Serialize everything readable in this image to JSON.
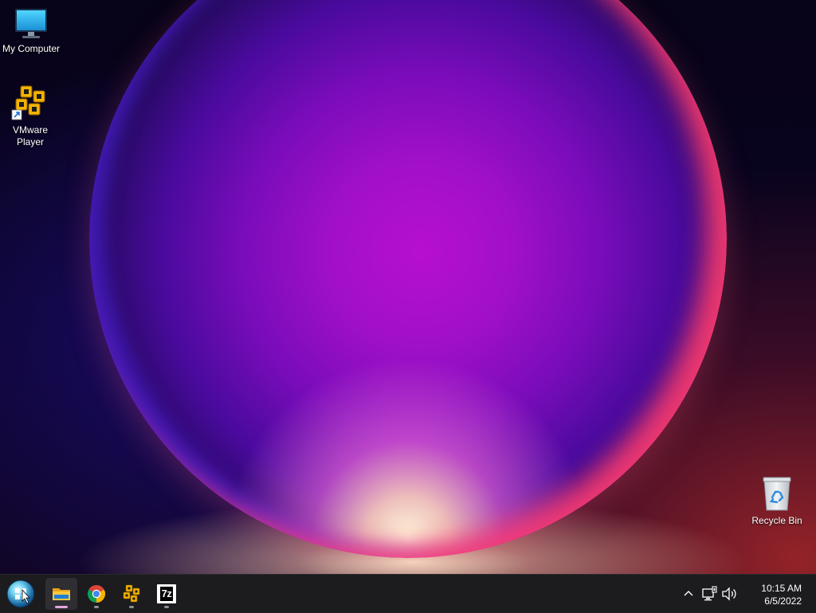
{
  "desktop": {
    "icons": [
      {
        "label": "My Computer",
        "icon": "monitor-icon"
      },
      {
        "label": "VMware\nPlayer",
        "icon": "vmware-player-icon"
      },
      {
        "label": "Recycle Bin",
        "icon": "recycle-bin-icon"
      }
    ]
  },
  "taskbar": {
    "start": {
      "icon": "start-orb-icon"
    },
    "pinned": [
      {
        "app": "File Explorer",
        "icon": "folder-icon",
        "active": true
      },
      {
        "app": "Chrome",
        "icon": "chrome-icon",
        "active": false
      },
      {
        "app": "VMware Player",
        "icon": "vmware-player-icon",
        "active": false
      },
      {
        "app": "7-Zip",
        "icon": "7z-icon",
        "active": false,
        "glyph_text": "7z"
      }
    ],
    "tray": {
      "icons": [
        "chevron-up-icon",
        "network-icon",
        "volume-icon"
      ],
      "time": "10:15 AM",
      "date": "6/5/2022"
    }
  },
  "colors": {
    "taskbar_bg": "#1c1c1f",
    "active_indicator": "#e3a6dc",
    "orb_accent": "#b70fd0"
  }
}
